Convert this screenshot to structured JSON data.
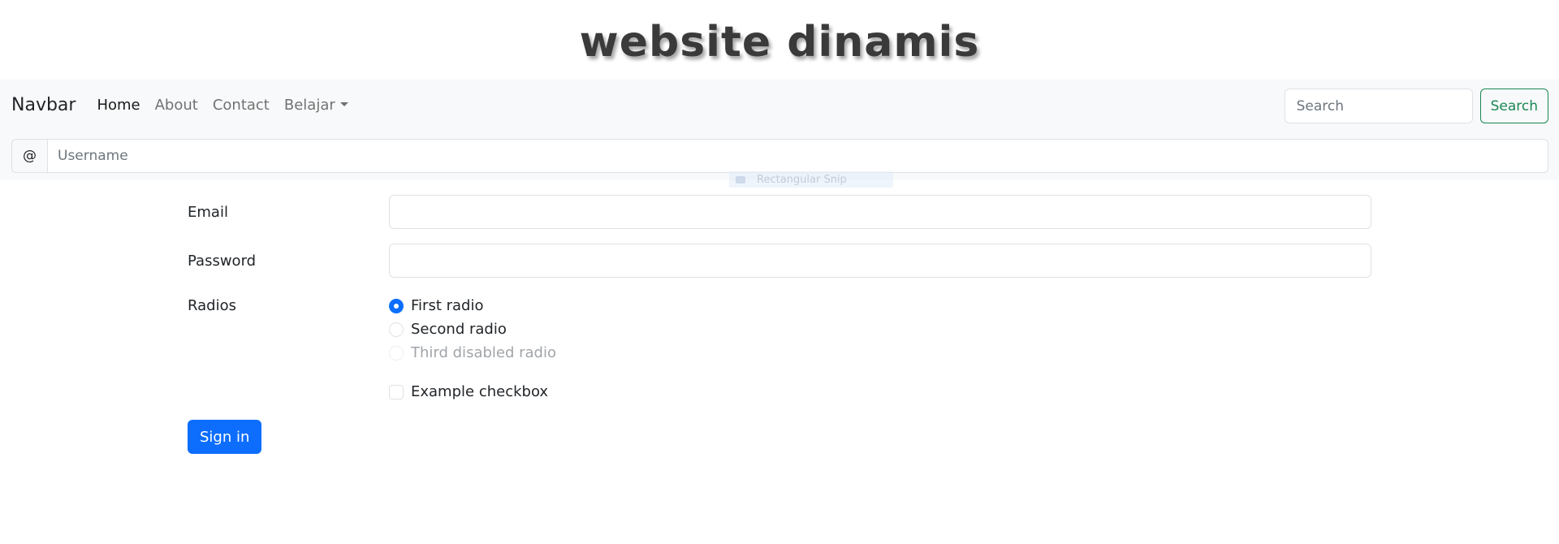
{
  "site": {
    "title": "website dinamis"
  },
  "navbar": {
    "brand": "Navbar",
    "links": [
      {
        "label": "Home",
        "active": true
      },
      {
        "label": "About"
      },
      {
        "label": "Contact"
      },
      {
        "label": "Belajar",
        "dropdown": true
      }
    ],
    "search_placeholder": "Search",
    "search_button": "Search"
  },
  "username_group": {
    "addon": "@",
    "placeholder": "Username"
  },
  "snip_overlay": {
    "label": "Rectangular Snip"
  },
  "form": {
    "email_label": "Email",
    "password_label": "Password",
    "radios_label": "Radios",
    "radios": [
      {
        "label": "First radio",
        "checked": true
      },
      {
        "label": "Second radio"
      },
      {
        "label": "Third disabled radio",
        "disabled": true
      }
    ],
    "checkbox_label": "Example checkbox",
    "submit": "Sign in"
  },
  "colors": {
    "primary": "#0d6efd",
    "success": "#198754",
    "navbar_bg": "#f8f9fa"
  }
}
